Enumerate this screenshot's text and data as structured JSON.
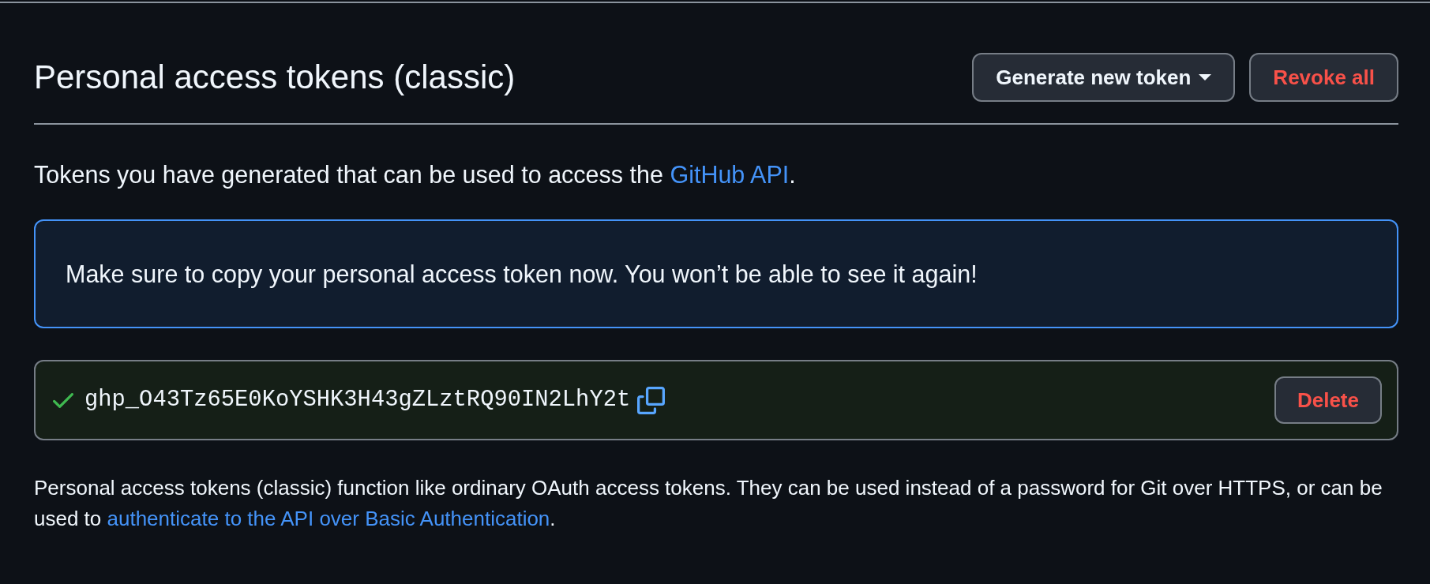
{
  "page": {
    "title": "Personal access tokens (classic)"
  },
  "header_buttons": [
    {
      "label": "Generate new token",
      "kind": "dropdown"
    },
    {
      "label": "Revoke all",
      "kind": "danger"
    }
  ],
  "intro": {
    "text": "Tokens you have generated that can be used to access the ",
    "link": "GitHub API",
    "after": "."
  },
  "flash": {
    "message": "Make sure to copy your personal access token now. You won’t be able to see it again!"
  },
  "tokens": [
    {
      "value": "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",
      "delete_label": "Delete"
    }
  ],
  "note": {
    "text": "Personal access tokens (classic) function like ordinary OAuth access tokens. They can be used instead of a password for Git over HTTPS, or can be used to ",
    "link": "authenticate to the API over Basic Authentication",
    "after": "."
  }
}
